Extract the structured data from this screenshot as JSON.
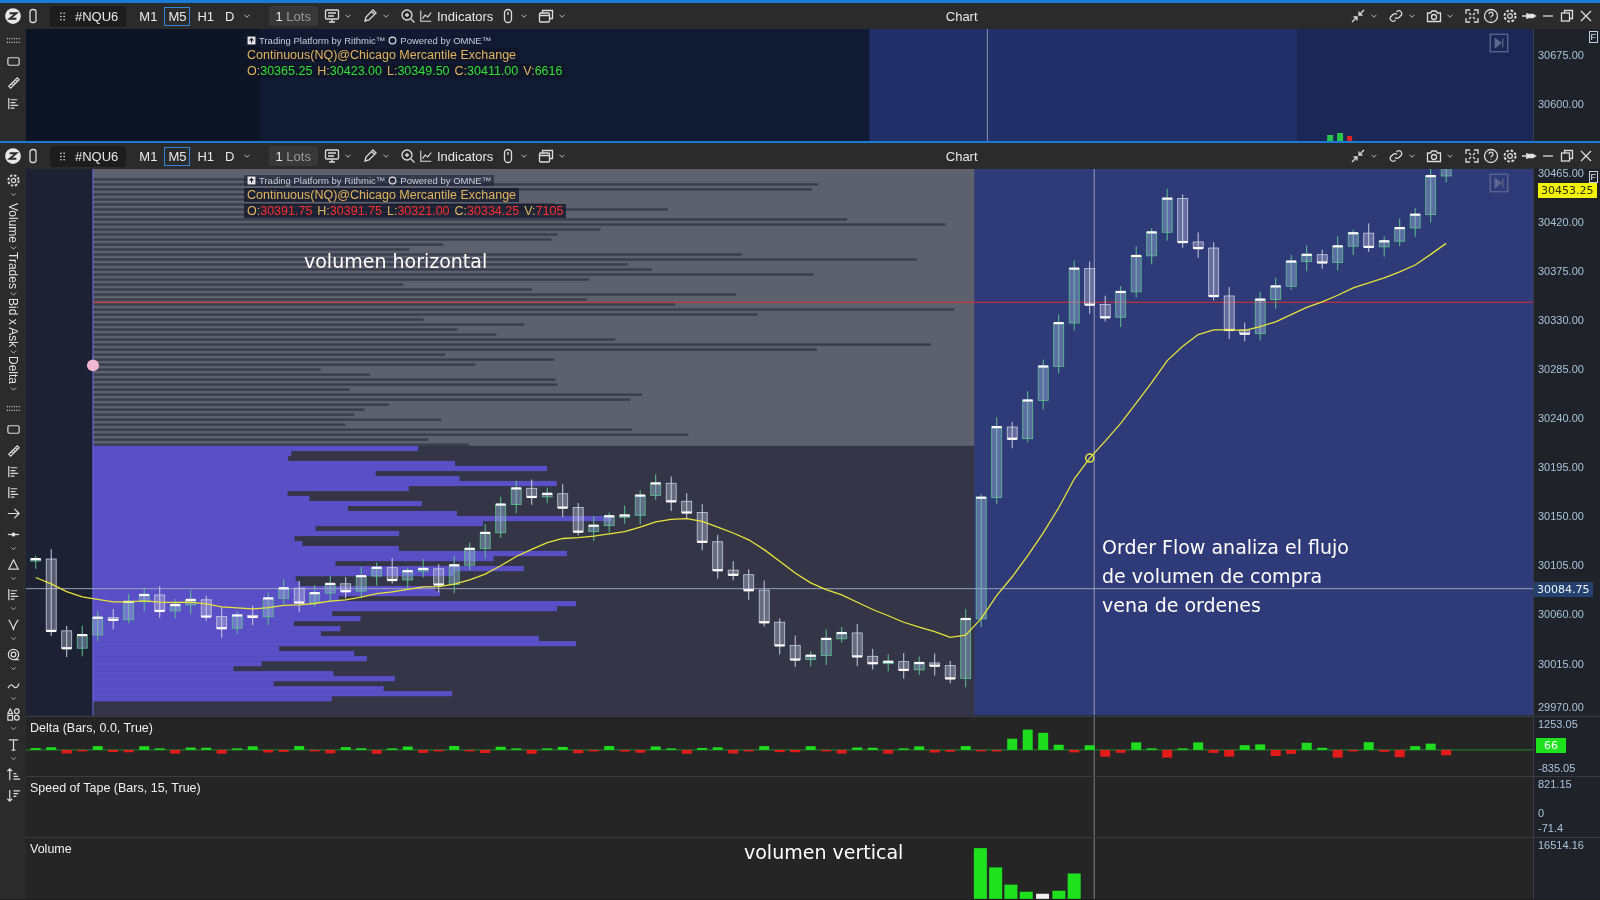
{
  "windows": [
    {
      "kind": "overview",
      "toolbar": {
        "symbol": "#NQU6",
        "timeframes": [
          {
            "label": "M1",
            "selected": false
          },
          {
            "label": "M5",
            "selected": true
          },
          {
            "label": "H1",
            "selected": false
          },
          {
            "label": "D",
            "selected": false
          }
        ],
        "lots_count": "1",
        "lots_unit": "Lots",
        "indicators": "Indicators",
        "title": "Chart"
      },
      "legend": {
        "platform": "Trading Platform by Rithmic™",
        "powered": "Powered by OMNE™",
        "instrument": "Continuous(NQ)@Chicago Mercantile Exchange",
        "rising": true,
        "ohlcv": [
          {
            "label": "O:",
            "value": "30365.25"
          },
          {
            "label": "H:",
            "value": "30423.00"
          },
          {
            "label": "L:",
            "value": "30349.50"
          },
          {
            "label": "C:",
            "value": "30411.00"
          },
          {
            "label": "V:",
            "value": "6616"
          }
        ]
      },
      "axis_flag": "F",
      "price_axis": [
        "30675.00",
        "30600.00"
      ]
    },
    {
      "kind": "main",
      "toolbar": {
        "symbol": "#NQU6",
        "timeframes": [
          {
            "label": "M1",
            "selected": false
          },
          {
            "label": "M5",
            "selected": true
          },
          {
            "label": "H1",
            "selected": false
          },
          {
            "label": "D",
            "selected": false
          }
        ],
        "lots_count": "1",
        "lots_unit": "Lots",
        "indicators": "Indicators",
        "title": "Chart"
      },
      "legend": {
        "platform": "Trading Platform by Rithmic™",
        "powered": "Powered by OMNE™",
        "instrument": "Continuous(NQ)@Chicago Mercantile Exchange",
        "rising": false,
        "ohlcv": [
          {
            "label": "O:",
            "value": "30391.75"
          },
          {
            "label": "H:",
            "value": "30391.75"
          },
          {
            "label": "L:",
            "value": "30321.00"
          },
          {
            "label": "C:",
            "value": "30334.25"
          },
          {
            "label": "V:",
            "value": "7105"
          }
        ]
      },
      "axis_flag": "F",
      "price_axis": [
        "30465.00",
        "30420.00",
        "30375.00",
        "30330.00",
        "30285.00",
        "30240.00",
        "30195.00",
        "30150.00",
        "30105.00",
        "30060.00",
        "30015.00",
        "29970.00"
      ],
      "last_price_tag": "30453.25",
      "crosshair_price_tag": "30084.75",
      "side_tabs": [
        {
          "label": "Volume",
          "selected": false
        },
        {
          "label": "Trades",
          "selected": false
        },
        {
          "label": "Bid x Ask",
          "selected": false
        },
        {
          "label": "Delta",
          "selected": false
        }
      ],
      "annotations": [
        "volumen horizontal",
        "Order Flow analiza el flujo\nde volumen de compra\nvena de ordenes"
      ],
      "panels": [
        {
          "kind": "delta",
          "title": "Delta (Bars, 0.0, True)",
          "axis": [
            "1253.05",
            "-835.05"
          ],
          "value_tag": "66"
        },
        {
          "kind": "speed",
          "title": "Speed of Tape (Bars, 15, True)",
          "axis": [
            "821.15",
            "0",
            "-71.4"
          ]
        },
        {
          "kind": "volume",
          "title": "Volume",
          "axis": [
            "16514.16"
          ],
          "annotation": "volumen vertical"
        }
      ]
    }
  ]
}
